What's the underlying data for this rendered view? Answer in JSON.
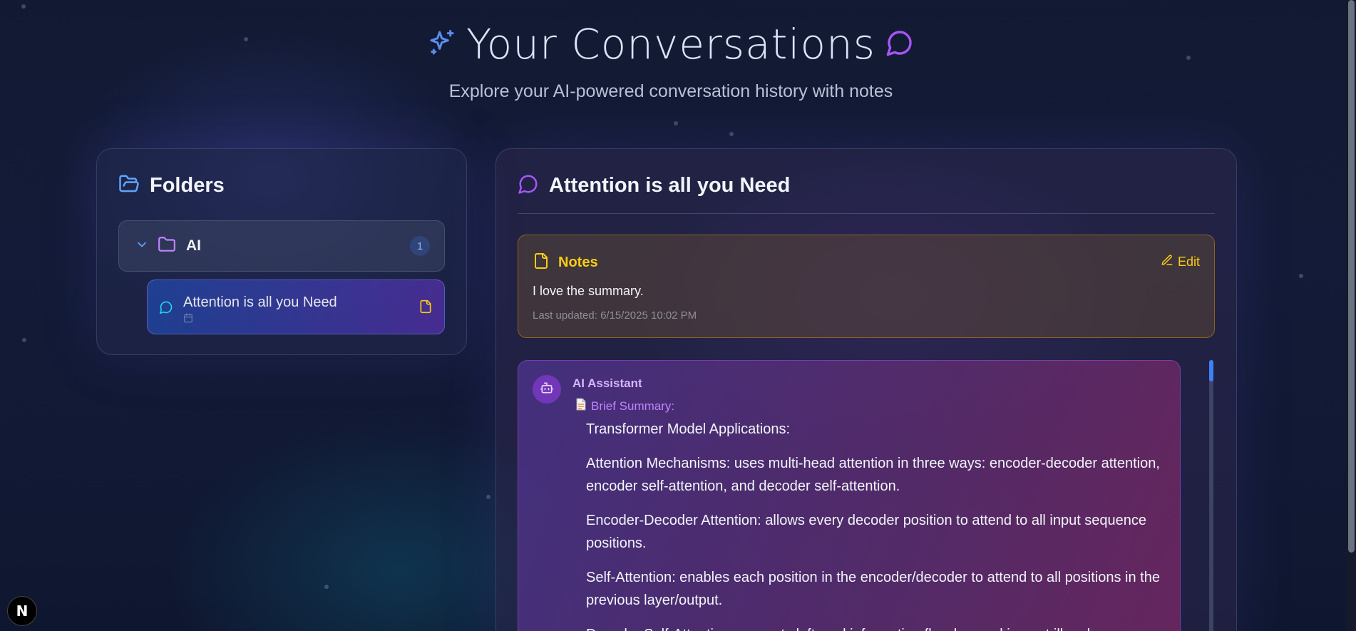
{
  "header": {
    "title": "Your Conversations",
    "subtitle": "Explore your AI-powered conversation history with notes"
  },
  "folders": {
    "title": "Folders",
    "items": [
      {
        "name": "AI",
        "count": "1",
        "expanded": true,
        "conversations": [
          {
            "title": "Attention is all you Need",
            "has_note": true,
            "selected": true
          }
        ]
      }
    ]
  },
  "conversation": {
    "title": "Attention is all you Need",
    "notes": {
      "title": "Notes",
      "edit_label": "Edit",
      "body": "I love the summary.",
      "updated": "Last updated: 6/15/2025 10:02 PM"
    },
    "message": {
      "sender": "AI Assistant",
      "summary_label": "Brief Summary:",
      "paragraphs": [
        "Transformer Model Applications:",
        "Attention Mechanisms: uses multi-head attention in three ways: encoder-decoder attention, encoder self-attention, and decoder self-attention.",
        "Encoder-Decoder Attention: allows every decoder position to attend to all input sequence positions.",
        "Self-Attention: enables each position in the encoder/decoder to attend to all positions in the previous layer/output.",
        "Decoder Self-Attention: prevents leftward information flow by masking out illegal"
      ]
    }
  },
  "dev_badge": "N",
  "colors": {
    "accent_blue": "#3b82f6",
    "accent_purple": "#a855f7",
    "notes_yellow": "#facc15",
    "icon_cyan": "#22d3ee"
  },
  "icons": [
    "sparkles-icon",
    "message-circle-icon",
    "folder-open-icon",
    "chevron-down-icon",
    "folder-icon",
    "calendar-icon",
    "note-icon",
    "edit-pencil-icon",
    "bot-icon",
    "document-emoji-icon"
  ]
}
